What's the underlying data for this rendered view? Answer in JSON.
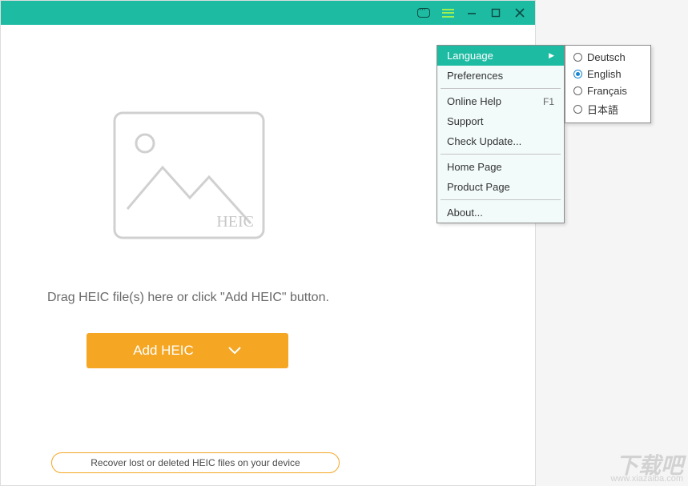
{
  "titlebar": {
    "chat_icon": "chat-icon",
    "menu_icon": "hamburger-icon",
    "minimize_icon": "minimize-icon",
    "maximize_icon": "maximize-icon",
    "close_icon": "close-icon"
  },
  "content": {
    "illustration_badge": "HEIC",
    "drag_text": "Drag HEIC file(s) here or click \"Add HEIC\" button.",
    "add_button_label": "Add HEIC",
    "recover_link": "Recover lost or deleted HEIC files on your device"
  },
  "menu": {
    "items": [
      {
        "label": "Language",
        "highlighted": true,
        "has_submenu": true
      },
      {
        "label": "Preferences"
      },
      {
        "sep": true
      },
      {
        "label": "Online Help",
        "shortcut": "F1"
      },
      {
        "label": "Support"
      },
      {
        "label": "Check Update..."
      },
      {
        "sep": true
      },
      {
        "label": "Home Page"
      },
      {
        "label": "Product Page"
      },
      {
        "sep": true
      },
      {
        "label": "About..."
      }
    ]
  },
  "language_submenu": {
    "options": [
      {
        "label": "Deutsch",
        "selected": false
      },
      {
        "label": "English",
        "selected": true
      },
      {
        "label": "Français",
        "selected": false
      },
      {
        "label": "日本語",
        "selected": false
      }
    ]
  },
  "watermark": {
    "main": "下载吧",
    "sub": "www.xiazaiba.com"
  },
  "colors": {
    "accent": "#1ebba3",
    "button": "#f5a623"
  }
}
